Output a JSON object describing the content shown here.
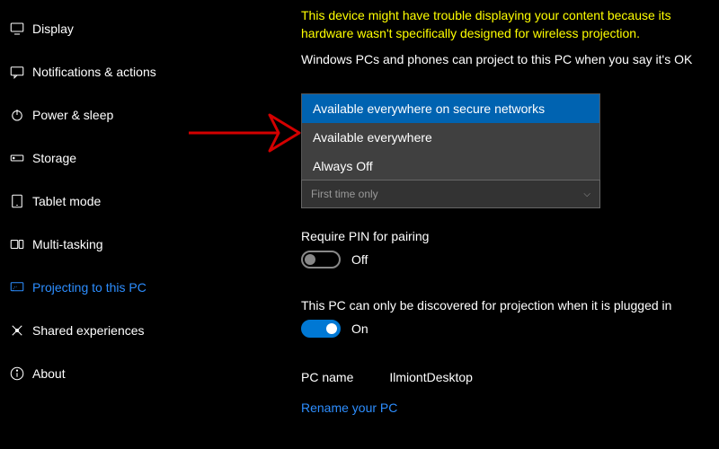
{
  "sidebar": {
    "items": [
      {
        "label": "Display"
      },
      {
        "label": "Notifications & actions"
      },
      {
        "label": "Power & sleep"
      },
      {
        "label": "Storage"
      },
      {
        "label": "Tablet mode"
      },
      {
        "label": "Multi-tasking"
      },
      {
        "label": "Projecting to this PC"
      },
      {
        "label": "Shared experiences"
      },
      {
        "label": "About"
      }
    ]
  },
  "main": {
    "warning": "This device might have trouble displaying your content because its hardware wasn't specifically designed for wireless projection.",
    "project_label": "Windows PCs and phones can project to this PC when you say it's OK",
    "dropdown": {
      "options": [
        "Available everywhere on secure networks",
        "Available everywhere",
        "Always Off"
      ]
    },
    "second_select": {
      "value": "First time only"
    },
    "pin": {
      "label": "Require PIN for pairing",
      "state": "Off"
    },
    "discover": {
      "label": "This PC can only be discovered for projection when it is plugged in",
      "state": "On"
    },
    "pc": {
      "name_label": "PC name",
      "name_value": "IlmiontDesktop",
      "rename": "Rename your PC"
    }
  }
}
